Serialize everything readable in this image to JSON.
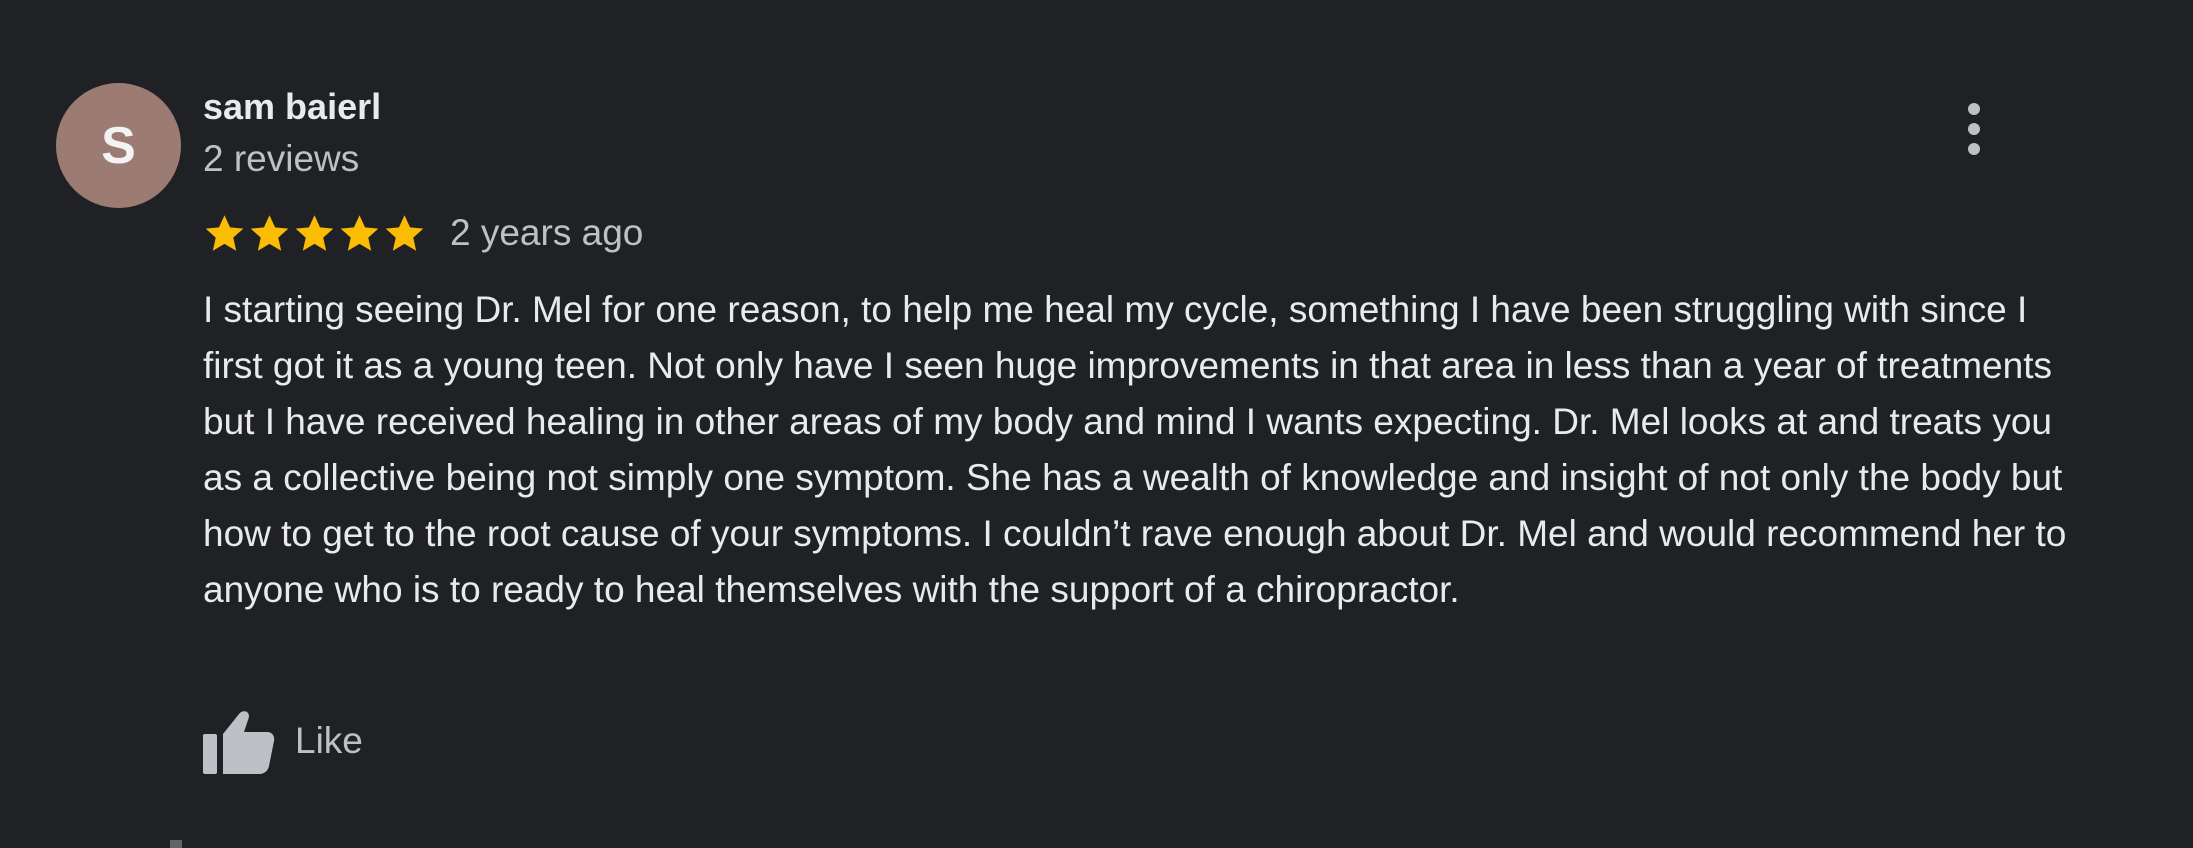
{
  "review": {
    "avatar_letter": "S",
    "avatar_color": "#9c7b73",
    "author_name": "sam baierl",
    "review_count": "2 reviews",
    "rating": 5,
    "rating_max": 5,
    "star_color": "#fbbc04",
    "timestamp": "2 years ago",
    "text": "I starting seeing Dr. Mel for one reason, to help me heal my cycle, something I have been struggling with since I first got it as a young teen. Not only have I seen huge improvements in that area in less than a year of treatments but I have received healing in other areas of my body and mind I wants expecting. Dr. Mel looks at and treats you as a collective being not simply one symptom. She has a wealth of knowledge and insight of not only the body but how to get to the root cause of your symptoms. I couldn’t rave enough about Dr. Mel and would recommend her to anyone who is to ready to heal themselves with the support of a chiropractor.",
    "like_label": "Like",
    "icons": {
      "more": "more-vert-icon",
      "star": "star-icon",
      "like": "thumbs-up-icon"
    }
  },
  "colors": {
    "background": "#202124",
    "primary_text": "#e8eaed",
    "secondary_text": "#bdc1c6"
  }
}
